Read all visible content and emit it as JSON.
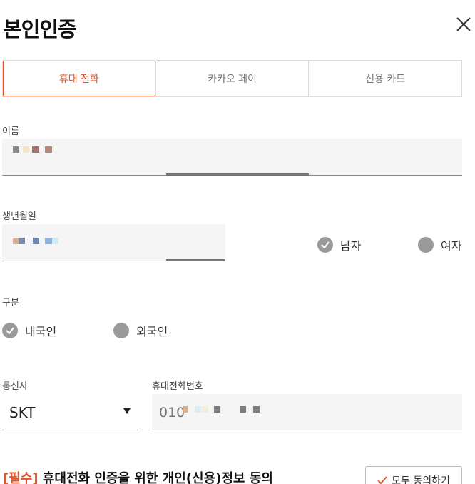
{
  "header": {
    "title": "본인인증",
    "close_icon": "close-icon"
  },
  "tabs": [
    {
      "label": "휴대 전화",
      "active": true
    },
    {
      "label": "카카오 페이",
      "active": false
    },
    {
      "label": "신용 카드",
      "active": false
    }
  ],
  "name_field": {
    "label": "이름"
  },
  "birth_field": {
    "label": "생년월일"
  },
  "gender": {
    "options": [
      {
        "label": "남자",
        "selected": true
      },
      {
        "label": "여자",
        "selected": false
      }
    ]
  },
  "nationality": {
    "label": "구분",
    "options": [
      {
        "label": "내국인",
        "selected": true
      },
      {
        "label": "외국인",
        "selected": false
      }
    ]
  },
  "carrier": {
    "label": "통신사",
    "value": "SKT"
  },
  "phone": {
    "label": "휴대전화번호",
    "prefix": "010"
  },
  "consent": {
    "required_tag": "[필수]",
    "text": " 휴대전화 인증을 위한 개인(신용)정보 동의",
    "agree_all_label": "모두 동의하기"
  },
  "colors": {
    "accent": "#e2572c",
    "radio": "#9a9a9a",
    "field_bg": "#f5f5f5"
  }
}
